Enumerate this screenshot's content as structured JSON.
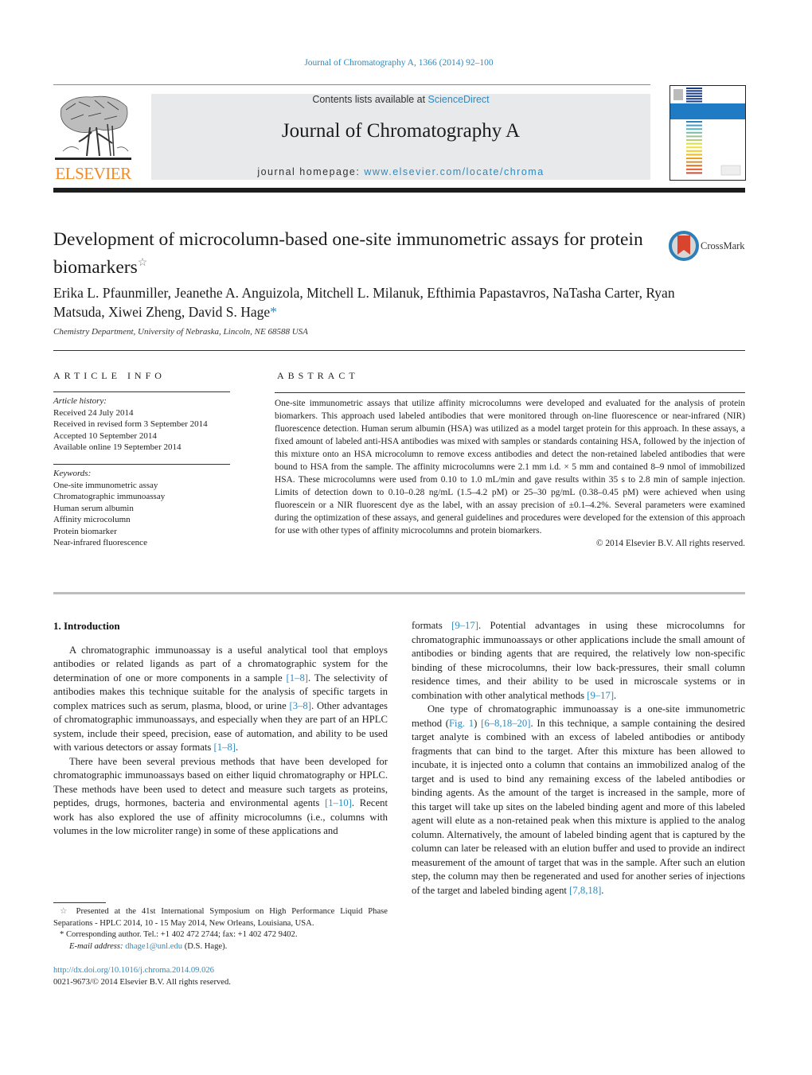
{
  "header": {
    "citation": "Journal of Chromatography A, 1366 (2014) 92–100",
    "publisher_logo_text": "ELSEVIER",
    "contents_prefix": "Contents lists available at ",
    "contents_link": "ScienceDirect",
    "journal_title": "Journal of Chromatography A",
    "homepage_prefix": "journal homepage: ",
    "homepage_link": "www.elsevier.com/locate/chroma",
    "cover_colors": [
      "#1b3f8c",
      "#1b3f8c",
      "#1b3f8c",
      "#1b3f8c",
      "#1b3f8c",
      "#1b3f8c",
      "#2b86c9",
      "#3aa0d8",
      "#5bb3c6",
      "#79bba8",
      "#9ac489",
      "#b8cf6e",
      "#d9dc4c",
      "#f2e22b",
      "#f3cf1d",
      "#efb91e",
      "#e9a11f",
      "#e38a22",
      "#de7226",
      "#d85b2c",
      "#d24a32"
    ]
  },
  "article": {
    "title": "Development of microcolumn-based one-site immunometric assays for protein biomarkers",
    "title_marker": "☆",
    "crossmark_label": "CrossMark",
    "authors": "Erika L. Pfaunmiller, Jeanethe A. Anguizola, Mitchell L. Milanuk, Efthimia Papastavros, NaTasha Carter, Ryan Matsuda, Xiwei Zheng, David S. Hage",
    "corresponding_marker": "*",
    "affiliation": "Chemistry Department, University of Nebraska, Lincoln, NE 68588 USA"
  },
  "article_info": {
    "heading": "ARTICLE INFO",
    "history_label": "Article history:",
    "history": [
      "Received 24 July 2014",
      "Received in revised form 3 September 2014",
      "Accepted 10 September 2014",
      "Available online 19 September 2014"
    ],
    "keywords_label": "Keywords:",
    "keywords": [
      "One-site immunometric assay",
      "Chromatographic immunoassay",
      "Human serum albumin",
      "Affinity microcolumn",
      "Protein biomarker",
      "Near-infrared fluorescence"
    ]
  },
  "abstract": {
    "heading": "ABSTRACT",
    "text": "One-site immunometric assays that utilize affinity microcolumns were developed and evaluated for the analysis of protein biomarkers. This approach used labeled antibodies that were monitored through on-line fluorescence or near-infrared (NIR) fluorescence detection. Human serum albumin (HSA) was utilized as a model target protein for this approach. In these assays, a fixed amount of labeled anti-HSA antibodies was mixed with samples or standards containing HSA, followed by the injection of this mixture onto an HSA microcolumn to remove excess antibodies and detect the non-retained labeled antibodies that were bound to HSA from the sample. The affinity microcolumns were 2.1 mm i.d. × 5 mm and contained 8–9 nmol of immobilized HSA. These microcolumns were used from 0.10 to 1.0 mL/min and gave results within 35 s to 2.8 min of sample injection. Limits of detection down to 0.10–0.28 ng/mL (1.5–4.2 pM) or 25–30 pg/mL (0.38–0.45 pM) were achieved when using fluorescein or a NIR fluorescent dye as the label, with an assay precision of ±0.1–4.2%. Several parameters were examined during the optimization of these assays, and general guidelines and procedures were developed for the extension of this approach for use with other types of affinity microcolumns and protein biomarkers.",
    "copyright": "© 2014 Elsevier B.V. All rights reserved."
  },
  "body": {
    "section_heading": "1.  Introduction",
    "left_col": [
      [
        {
          "t": "A chromatographic immunoassay is a useful analytical tool that employs antibodies or related ligands as part of a chromatographic system for the determination of one or more components in a sample "
        },
        {
          "ref": "[1–8]"
        },
        {
          "t": ". The selectivity of antibodies makes this technique suitable for the analysis of specific targets in complex matrices such as serum, plasma, blood, or urine "
        },
        {
          "ref": "[3–8]"
        },
        {
          "t": ". Other advantages of chromatographic immunoassays, and especially when they are part of an HPLC system, include their speed, precision, ease of automation, and ability to be used with various detectors or assay formats "
        },
        {
          "ref": "[1–8]"
        },
        {
          "t": "."
        }
      ],
      [
        {
          "t": "There have been several previous methods that have been developed for chromatographic immunoassays based on either liquid chromatography or HPLC. These methods have been used to detect and measure such targets as proteins, peptides, drugs, hormones, bacteria and environmental agents "
        },
        {
          "ref": "[1–10]"
        },
        {
          "t": ". Recent work has also explored the use of affinity microcolumns (i.e., columns with volumes in the low microliter range) in some of these applications and"
        }
      ]
    ],
    "right_col": [
      [
        {
          "t": "formats "
        },
        {
          "ref": "[9–17]"
        },
        {
          "t": ". Potential advantages in using these microcolumns for chromatographic immunoassays or other applications include the small amount of antibodies or binding agents that are required, the relatively low non-specific binding of these microcolumns, their low back-pressures, their small column residence times, and their ability to be used in microscale systems or in combination with other analytical methods "
        },
        {
          "ref": "[9–17]"
        },
        {
          "t": "."
        }
      ],
      [
        {
          "t": "One type of chromatographic immunoassay is a one-site immunometric method ("
        },
        {
          "ref": "Fig. 1"
        },
        {
          "t": ") "
        },
        {
          "ref": "[6–8,18–20]"
        },
        {
          "t": ". In this technique, a sample containing the desired target analyte is combined with an excess of labeled antibodies or antibody fragments that can bind to the target. After this mixture has been allowed to incubate, it is injected onto a column that contains an immobilized analog of the target and is used to bind any remaining excess of the labeled antibodies or binding agents. As the amount of the target is increased in the sample, more of this target will take up sites on the labeled binding agent and more of this labeled agent will elute as a non-retained peak when this mixture is applied to the analog column. Alternatively, the amount of labeled binding agent that is captured by the column can later be released with an elution buffer and used to provide an indirect measurement of the amount of target that was in the sample. After such an elution step, the column may then be regenerated and used for another series of injections of the target and labeled binding agent "
        },
        {
          "ref": "[7,8,18]"
        },
        {
          "t": "."
        }
      ]
    ]
  },
  "footnotes": {
    "star_marker": "☆",
    "star_note": "Presented at the 41st International Symposium on High Performance Liquid Phase Separations - HPLC 2014, 10 - 15 May 2014, New Orleans, Louisiana, USA.",
    "corr_marker": "*",
    "corr_note": "Corresponding author. Tel.: +1 402 472 2744; fax: +1 402 472 9402.",
    "email_label": "E-mail address: ",
    "email": "dhage1@unl.edu",
    "email_suffix": " (D.S. Hage).",
    "doi": "http://dx.doi.org/10.1016/j.chroma.2014.09.026",
    "issn_copyright": "0021-9673/© 2014 Elsevier B.V. All rights reserved."
  }
}
